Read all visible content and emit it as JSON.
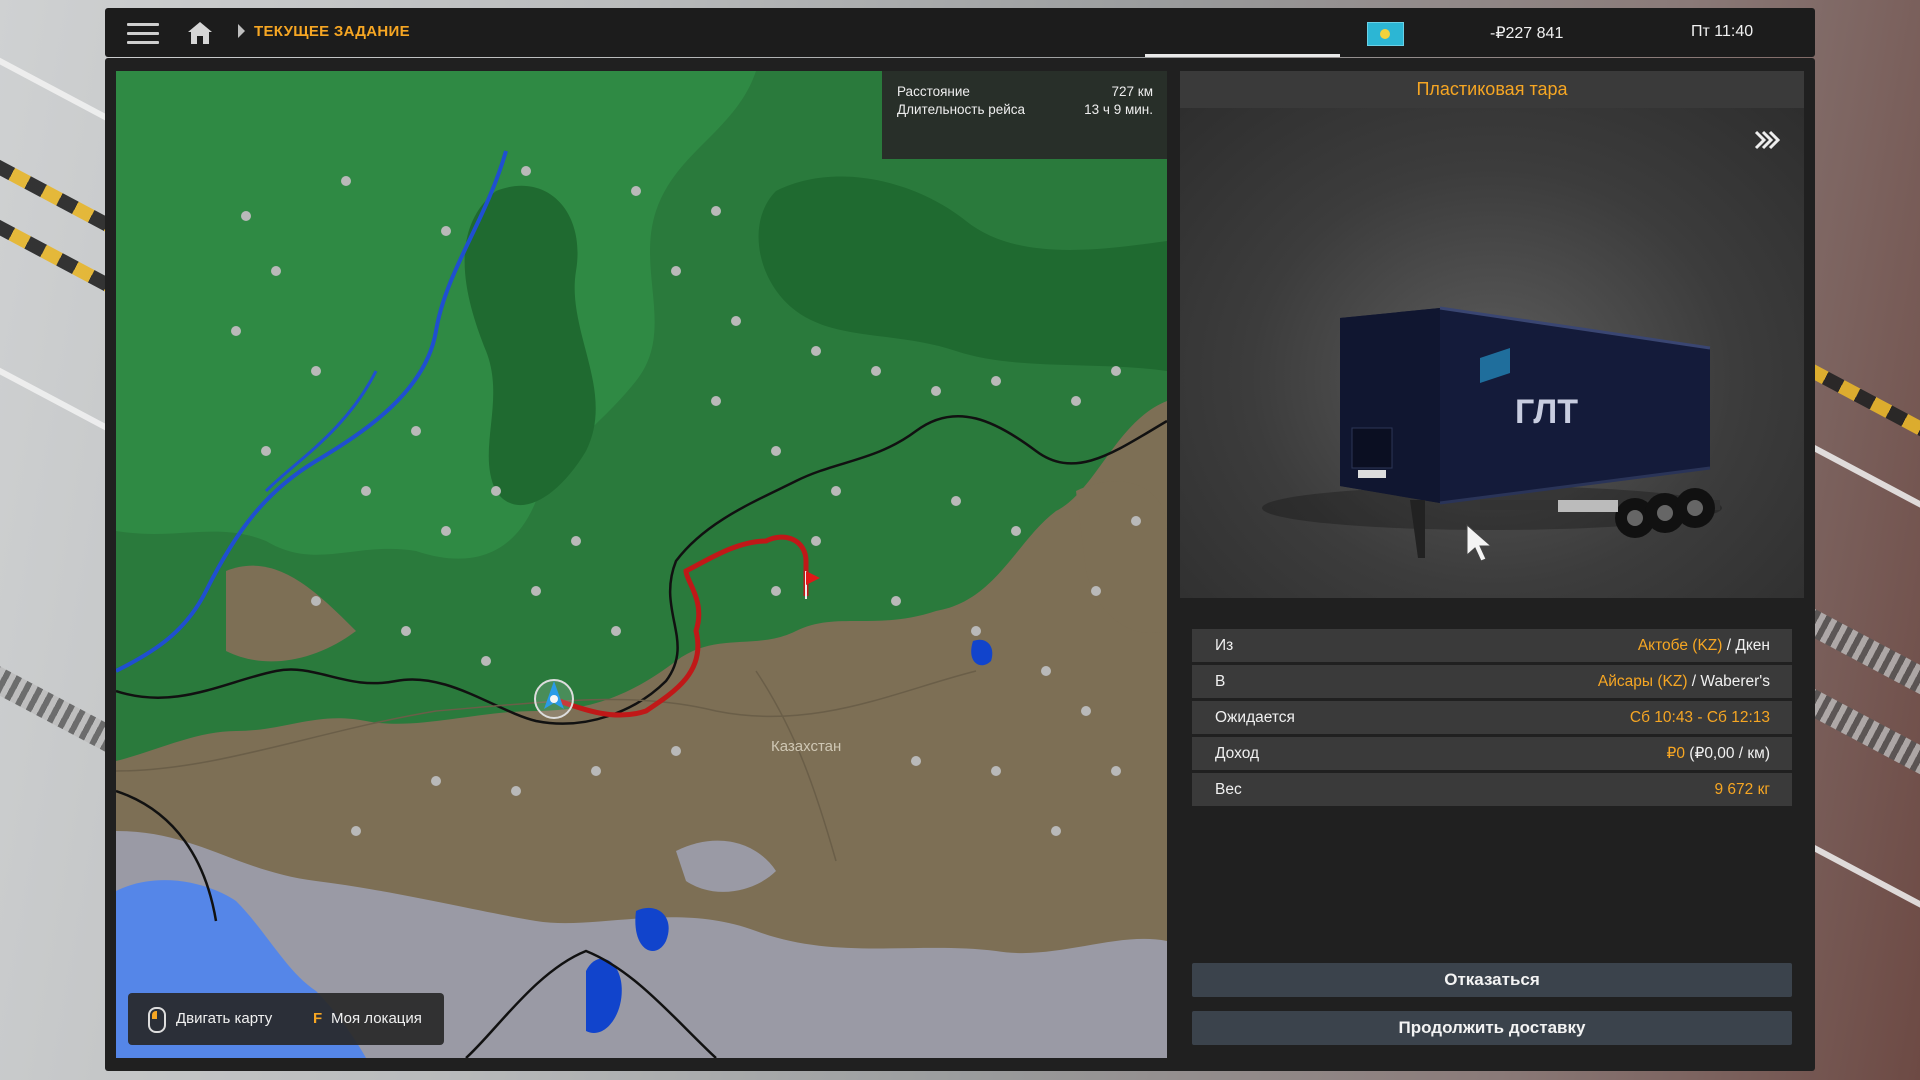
{
  "topbar": {
    "breadcrumb": "ТЕКУЩЕЕ ЗАДАНИЕ",
    "money": "-₽227 841",
    "time": "Пт 11:40"
  },
  "map": {
    "distance_label": "Расстояние",
    "distance_value": "727 км",
    "duration_label": "Длительность рейса",
    "duration_value": "13 ч 9 мин.",
    "country_label": "Казахстан",
    "move_map_label": "Двигать карту",
    "location_key": "F",
    "location_label": "Моя локация"
  },
  "cargo": {
    "title": "Пластиковая тара",
    "trailer_brand": "ГЛТ"
  },
  "details": [
    {
      "label": "Из",
      "value_accent": "Актобе (KZ)",
      "value_rest": " / Дкен"
    },
    {
      "label": "В",
      "value_accent": "Айсары (KZ)",
      "value_rest": " / Waberer's"
    },
    {
      "label": "Ожидается",
      "value_accent": "Сб 10:43 - Сб 12:13",
      "value_rest": ""
    },
    {
      "label": "Доход",
      "value_accent": "₽0",
      "value_rest": " (₽0,00 / км)"
    },
    {
      "label": "Вес",
      "value_accent": "9 672 кг",
      "value_rest": ""
    }
  ],
  "buttons": {
    "decline": "Отказаться",
    "continue": "Продолжить доставку"
  },
  "icons": {
    "menu": "hamburger-icon",
    "home": "home-icon",
    "flag": "kazakhstan-flag-icon",
    "skip": "fast-forward-icon",
    "mouse": "mouse-icon"
  }
}
